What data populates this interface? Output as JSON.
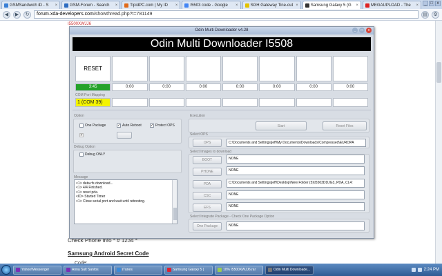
{
  "browser": {
    "tabs": [
      {
        "label": "GSMSandwich iD - S",
        "color": "#3a7fd5",
        "active": false
      },
      {
        "label": "GSM-Forum - Search",
        "color": "#2d6cc0",
        "active": false
      },
      {
        "label": "TipidPC.com | My ID",
        "color": "#e06a1a",
        "active": false
      },
      {
        "label": "I5503 code - Google",
        "color": "#4285f4",
        "active": false
      },
      {
        "label": "SGH Gateway Tine-out",
        "color": "#e3c200",
        "active": false
      },
      {
        "label": "Samsung Galaxy 5 (G",
        "color": "#333333",
        "active": true
      },
      {
        "label": "MEGAUPLOAD - The",
        "color": "#d22",
        "active": false
      }
    ],
    "url_host": "forum.xda-developers.com",
    "url_path": "/showthread.php?t=781149"
  },
  "page": {
    "crumb": "I5500XWJJ6",
    "line1": "Check Phone Info * # 1234 *",
    "heading": "Samsung Android Secret Code",
    "code_label": "Code:"
  },
  "odin": {
    "title": "Odin Multi Downloader v4.28",
    "banner": "Odin Multi Downloader I5508",
    "reset_label": "RESET",
    "timers": [
      "3:45",
      "0:00",
      "0:00",
      "0:00",
      "0:00",
      "0:00",
      "0:00",
      "0:00"
    ],
    "com_label": "COM Port Mapping",
    "com_active": "1 (COM 39)",
    "option_label": "Option",
    "one_package": "One Package",
    "auto_reboot": "Auto Reboot",
    "protect_ops": "Protect OPS",
    "debug_label": "Debug Option",
    "debug_only": "Debug ONLY",
    "execution_label": "Execution",
    "start": "Start",
    "reset_files": "Reset Files",
    "select_ops_label": "Select OPS",
    "ops_btn": "OPS",
    "ops_path": "C:\\Documents and Settings\\jeff\\My Documents\\Downloads\\Compressed\\EUROPA",
    "images_label": "Select Images to download",
    "boot_btn": "BOOT",
    "boot_val": "NONE",
    "phone_btn": "PHONE",
    "phone_val": "NONE",
    "pda_btn": "PDA",
    "pda_val": "C:\\Documents and Settings\\jeff\\Desktop\\New Folder (5)\\I5503DDJG3_PDA_CL4:",
    "csc_btn": "CSC",
    "csc_val": "NONE",
    "efs_btn": "EFS",
    "efs_val": "NONE",
    "integrate_label": "Select Integrate Package - Check One Package Option",
    "one_pkg_btn": "One Package",
    "one_pkg_val": "NONE",
    "message_label": "Message",
    "messages": [
      "<1> data.rfs download...",
      "<1> 4/4 Finished.",
      "<1> reset pda.",
      "<ID> Started Timer",
      "<1> Close serial port and wait until rebooting."
    ]
  },
  "taskbar": {
    "items": [
      {
        "label": "Yahoo!Messenger",
        "color": "#7b2fb5",
        "active": false
      },
      {
        "label": "Anna Sult Santos",
        "color": "#7b2fb5",
        "active": false
      },
      {
        "label": "iTunes",
        "color": "#3b8ad8",
        "active": false
      },
      {
        "label": "Samsung Galaxy 5 (",
        "color": "#d23",
        "active": false
      },
      {
        "label": "10% I5500XWJJ6.rar",
        "color": "#9c5",
        "active": false
      },
      {
        "label": "Odin Multi Downloade...",
        "color": "#777",
        "active": true
      }
    ],
    "clock": "2:24 PM"
  }
}
